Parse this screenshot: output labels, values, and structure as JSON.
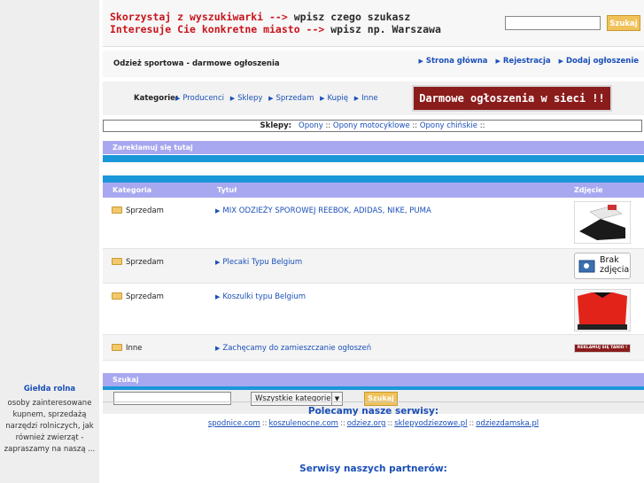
{
  "left_box": {
    "title": "Giełda rolna",
    "text": "osoby zainteresowane kupnem, sprzedażą narzędzi rolniczych, jak również zwierząt - zapraszamy na naszą ..."
  },
  "top": {
    "slogan_line1_a": "Skorzystaj z wyszukiwarki --> ",
    "slogan_line1_b": "wpisz czego szukasz",
    "slogan_line2_a": "Interesuje Cie konkretne miasto --> ",
    "slogan_line2_b": "wpisz np. Warszawa",
    "search_button": "Szukaj",
    "search_value": ""
  },
  "header": {
    "site_title": "Odzież sportowa - darmowe ogłoszenia",
    "nav": [
      "Strona główna",
      "Rejestracja",
      "Dodaj ogłoszenie"
    ]
  },
  "categories": {
    "label": "Kategorie:",
    "items": [
      "Producenci",
      "Sklepy",
      "Sprzedam",
      "Kupię",
      "Inne"
    ],
    "banner": "Darmowe ogłoszenia w sieci !!"
  },
  "shops": {
    "label": "Sklepy:",
    "items": [
      "Opony",
      "Opony motocyklowe",
      "Opony chińskie"
    ],
    "separator": " :: "
  },
  "ads_section": {
    "title": "Zareklamuj się tutaj"
  },
  "listing": {
    "headers": {
      "category": "Kategoria",
      "title": "Tytuł",
      "photo": "Zdjęcie"
    },
    "rows": [
      {
        "category": "Sprzedam",
        "title": "MIX ODZIEŻY SPOROWEJ REEBOK, ADIDAS, NIKE, PUMA",
        "photo": "clothes-photo"
      },
      {
        "category": "Sprzedam",
        "title": "Plecaki Typu Belgium",
        "photo": "no-photo",
        "no_photo_text": "Brak zdjęcia"
      },
      {
        "category": "Sprzedam",
        "title": "Koszulki typu Belgium",
        "photo": "red-shirt-photo"
      },
      {
        "category": "Inne",
        "title": "Zachęcamy do zamieszczanie ogłoszeń",
        "photo": "ad-banner-photo",
        "ad_text": "REKLAMUJ SIĘ TANIO !"
      }
    ]
  },
  "search": {
    "title": "Szukaj",
    "input_value": "",
    "select_value": "Wszystkie kategorie",
    "button": "Szukaj"
  },
  "footer": {
    "recommended_title": "Polecamy nasze serwisy:",
    "recommended_links": [
      "spodnice.com",
      "koszulenocne.com",
      "odziez.org",
      "sklepyodziezowe.pl",
      "odziezdamska.pl"
    ],
    "partners_title": "Serwisy naszych partnerów:"
  },
  "colors": {
    "accent_blue": "#1a97d8",
    "header_purple": "#a8a8f0",
    "link": "#1a4fb8",
    "button_yellow": "#f0c25a",
    "banner_red": "#8a1c1c"
  }
}
